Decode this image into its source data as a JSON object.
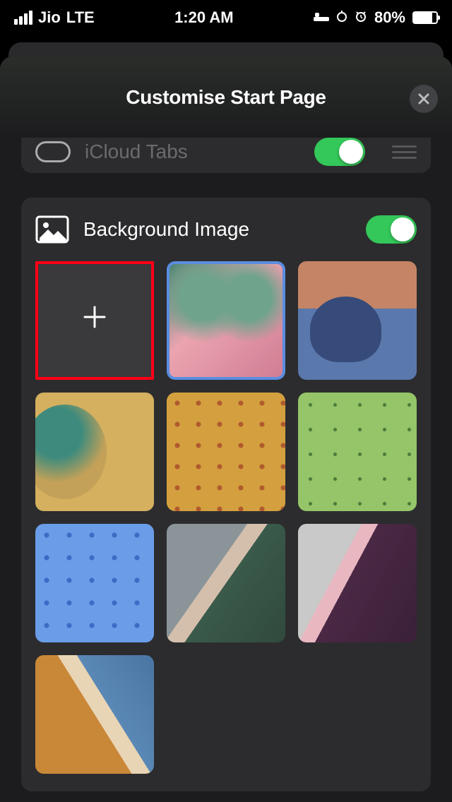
{
  "status_bar": {
    "carrier": "Jio",
    "network": "LTE",
    "time": "1:20 AM",
    "battery_percent": "80%"
  },
  "sheet": {
    "title": "Customise Start Page"
  },
  "icloud_row": {
    "label": "iCloud Tabs"
  },
  "background": {
    "label": "Background Image"
  }
}
